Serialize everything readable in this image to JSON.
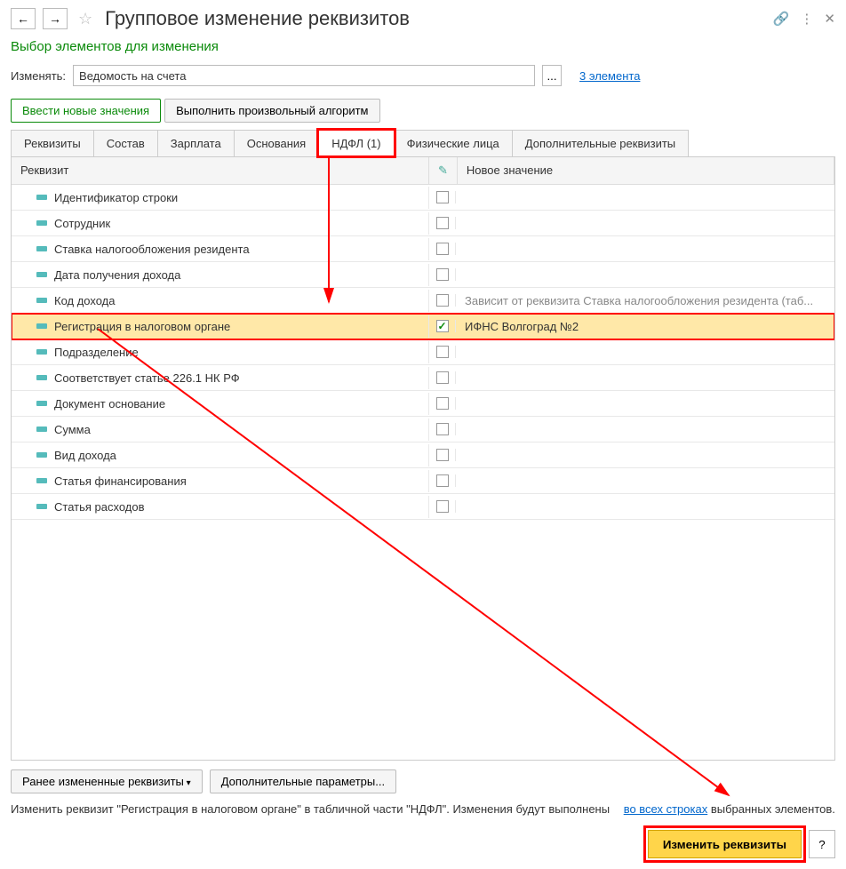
{
  "header": {
    "title": "Групповое изменение реквизитов"
  },
  "subtitle": "Выбор элементов для изменения",
  "change": {
    "label": "Изменять:",
    "value": "Ведомость на счета",
    "link": "3 элемента"
  },
  "actions": {
    "enter": "Ввести новые значения",
    "exec": "Выполнить произвольный алгоритм"
  },
  "tabs": [
    {
      "label": "Реквизиты"
    },
    {
      "label": "Состав"
    },
    {
      "label": "Зарплата"
    },
    {
      "label": "Основания"
    },
    {
      "label": "НДФЛ (1)"
    },
    {
      "label": "Физические лица"
    },
    {
      "label": "Дополнительные реквизиты"
    }
  ],
  "thead": {
    "c1": "Реквизит",
    "c3": "Новое значение"
  },
  "rows": [
    {
      "name": "Идентификатор строки",
      "checked": false,
      "val": ""
    },
    {
      "name": "Сотрудник",
      "checked": false,
      "val": ""
    },
    {
      "name": "Ставка налогообложения резидента",
      "checked": false,
      "val": ""
    },
    {
      "name": "Дата получения дохода",
      "checked": false,
      "val": ""
    },
    {
      "name": "Код дохода",
      "checked": false,
      "val": "Зависит от реквизита Ставка налогообложения резидента (таб..."
    },
    {
      "name": "Регистрация в налоговом органе",
      "checked": true,
      "val": "ИФНС Волгоград №2",
      "sel": true
    },
    {
      "name": "Подразделение",
      "checked": false,
      "val": ""
    },
    {
      "name": "Соответствует статье 226.1 НК РФ",
      "checked": false,
      "val": ""
    },
    {
      "name": "Документ основание",
      "checked": false,
      "val": ""
    },
    {
      "name": "Сумма",
      "checked": false,
      "val": ""
    },
    {
      "name": "Вид дохода",
      "checked": false,
      "val": ""
    },
    {
      "name": "Статья финансирования",
      "checked": false,
      "val": ""
    },
    {
      "name": "Статья расходов",
      "checked": false,
      "val": ""
    }
  ],
  "bottom": {
    "prev": "Ранее измененные реквизиты",
    "extra": "Дополнительные параметры..."
  },
  "info": {
    "t1": "Изменить реквизит \"Регистрация в налоговом органе\" в табличной части \"НДФЛ\". Изменения будут выполнены ",
    "link": "во всех строках",
    "t2": " выбранных элементов."
  },
  "footer": {
    "main": "Изменить реквизиты",
    "q": "?"
  }
}
